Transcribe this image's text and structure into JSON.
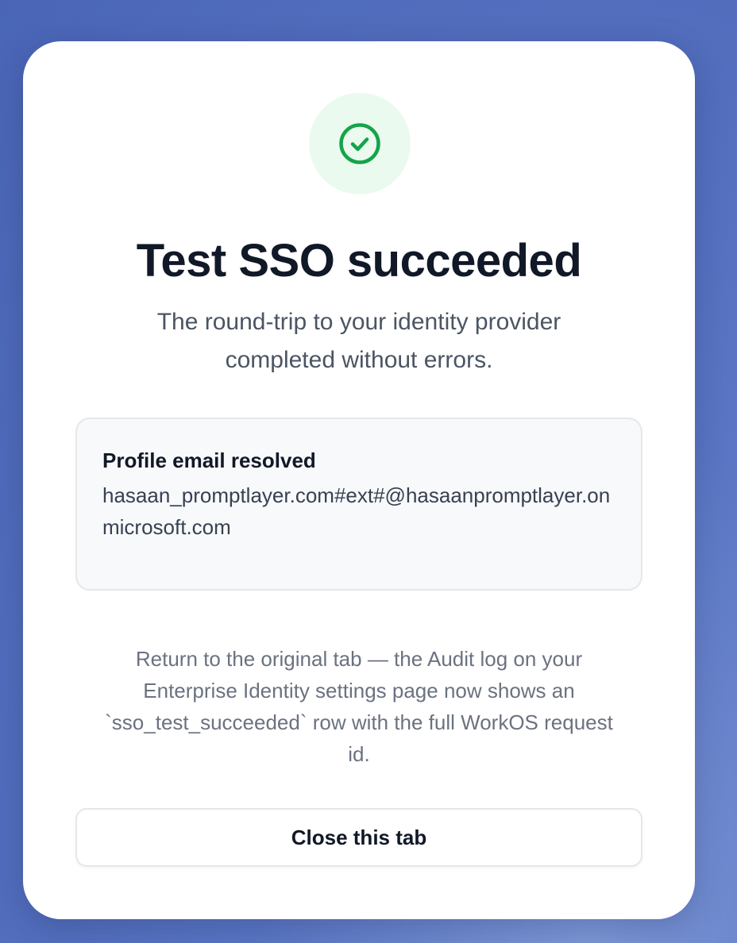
{
  "status": {
    "icon": "check-circle-icon",
    "color": "#16a34a",
    "background": "#eafaee"
  },
  "title": "Test SSO succeeded",
  "subtitle": "The round-trip to your identity provider completed without errors.",
  "profile": {
    "label": "Profile email resolved",
    "value": "hasaan_promptlayer.com#ext#@hasaanpromptlayer.onmicrosoft.com"
  },
  "note": "Return to the original tab — the Audit log on your Enterprise Identity settings page now shows an `sso_test_succeeded` row with the full WorkOS request id.",
  "actions": {
    "close_label": "Close this tab"
  }
}
